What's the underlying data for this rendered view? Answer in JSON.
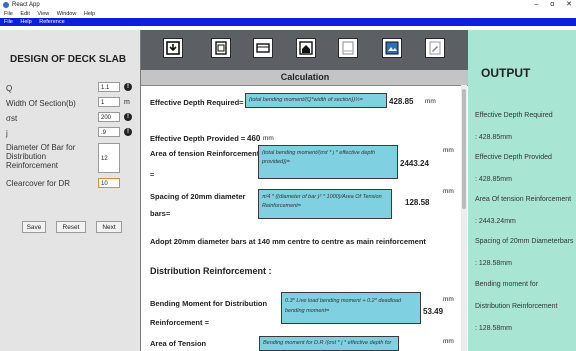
{
  "window": {
    "title": "React App",
    "min": "–",
    "max": "ɑ",
    "close": "✕"
  },
  "menu1": [
    "File",
    "Edit",
    "View",
    "Window",
    "Help"
  ],
  "menu2": [
    "File",
    "Help",
    "Reference"
  ],
  "left": {
    "title": "DESIGN OF DECK SLAB",
    "fields": [
      {
        "label": "Q",
        "value": "1.1",
        "unit": ""
      },
      {
        "label": "Width Of Section(b)",
        "value": "1",
        "unit": "m"
      },
      {
        "label": "σst",
        "value": "200",
        "unit": ""
      },
      {
        "label": "j",
        "value": ".9",
        "unit": ""
      }
    ],
    "diameter_label": [
      "Diameter Of Bar for",
      "Distribution",
      "Reinforcement"
    ],
    "diameter_value": "12",
    "clearcover_label": "Clearcover for DR",
    "clearcover_value": "10",
    "buttons": {
      "save": "Save",
      "reset": "Reset",
      "next": "Next"
    }
  },
  "center": {
    "header": "Calculation",
    "eff_req_label": "Effective Depth Required=",
    "eff_req_formula": "(total bending moment/(Q*width of section))½=",
    "eff_req_value": "428.85",
    "eff_req_unit": "mm",
    "eff_prov_label": "Effective Depth Provided =",
    "eff_prov_value": "460",
    "eff_prov_unit": "mm",
    "ast_label1": "Area of tension Reinforcement",
    "ast_label2": "=",
    "ast_formula": "(total bending moment/(σst * j * effective depth provided))=",
    "ast_value": "2443.24",
    "ast_unit": "mm",
    "spacing_label1": "Spacing of 20mm diameter",
    "spacing_label2": "bars=",
    "spacing_formula": "π/4 * ((diameter of bar )² * 1000)/Area Of Tension Reinforcement=",
    "spacing_value": "128.58",
    "spacing_unit": "mm",
    "adopt": "Adopt 20mm diameter bars at 140 mm centre to centre as main reinforcement",
    "dist_heading": "Distribution Reinforcement :",
    "bm_label1": "Bending Moment for Distribution",
    "bm_label2": "Reinforcement =",
    "bm_formula": "0.3* Live load bending moment + 0.2* deadload bending moment=",
    "bm_value": "53.49",
    "bm_unit": "mm",
    "area_label": "Area of Tension",
    "area_formula": "Bending moment for D.R /(σst * j * effective depth for",
    "area_unit": "mm"
  },
  "output": {
    "title": "OUTPUT",
    "lines": [
      "Effective Depth Required",
      ": 428.85mm",
      "Effective Depth Provided",
      ": 428.85mm",
      "Area Of tension Reinforcement",
      ": 2443.24mm",
      "Spacing of 20mm Diameterbars",
      ": 128.58mm",
      "Bending moment for",
      "Distribution Reinforcement",
      ": 128.58mm"
    ]
  }
}
